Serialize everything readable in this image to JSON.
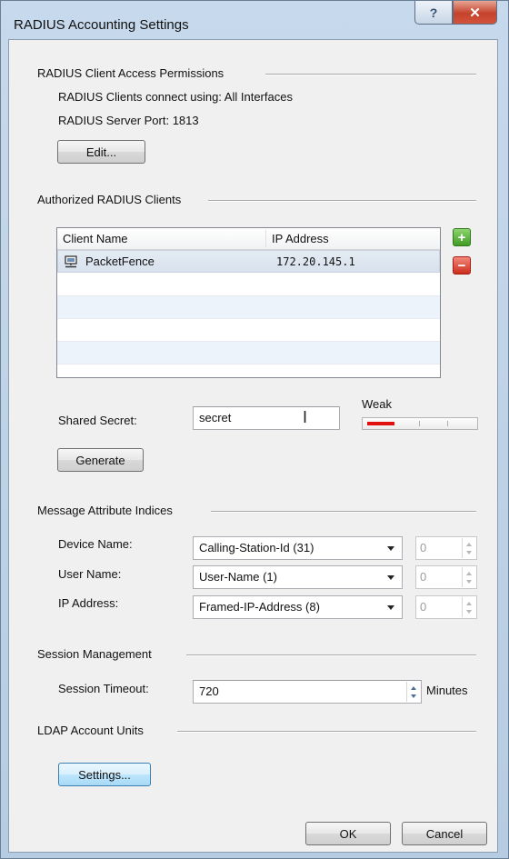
{
  "window": {
    "title": "RADIUS Accounting Settings",
    "help_glyph": "?",
    "close_glyph": "✕"
  },
  "access": {
    "heading": "RADIUS Client Access Permissions",
    "connect_text": "RADIUS Clients connect using: All Interfaces",
    "port_text": "RADIUS Server Port: 1813",
    "edit_label": "Edit..."
  },
  "clients": {
    "heading": "Authorized RADIUS Clients",
    "columns": [
      "Client Name",
      "IP Address"
    ],
    "rows": [
      {
        "name": "PacketFence",
        "ip": "172.20.145.1",
        "icon": "computer-icon"
      }
    ],
    "add_glyph": "+",
    "remove_glyph": "−"
  },
  "secret": {
    "label": "Shared Secret:",
    "value": "secret",
    "strength_label": "Weak",
    "strength_level": 0.25,
    "generate_label": "Generate"
  },
  "attributes": {
    "heading": "Message Attribute Indices",
    "rows": [
      {
        "label": "Device Name:",
        "value": "Calling-Station-Id (31)",
        "index": "0"
      },
      {
        "label": "User Name:",
        "value": "User-Name (1)",
        "index": "0"
      },
      {
        "label": "IP Address:",
        "value": "Framed-IP-Address (8)",
        "index": "0"
      }
    ]
  },
  "session": {
    "heading": "Session Management",
    "timeout_label": "Session Timeout:",
    "timeout_value": "720",
    "unit": "Minutes"
  },
  "ldap": {
    "heading": "LDAP Account Units",
    "settings_label": "Settings..."
  },
  "footer": {
    "ok_label": "OK",
    "cancel_label": "Cancel"
  },
  "colors": {
    "strength_weak": "#e0100e",
    "add": "#3f9b25",
    "remove": "#cc2e1d"
  }
}
